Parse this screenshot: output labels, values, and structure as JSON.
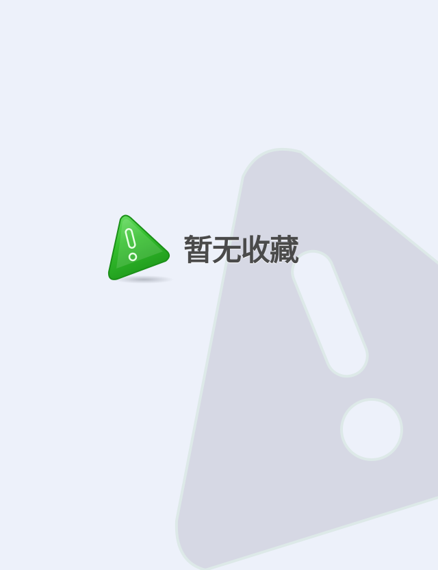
{
  "empty_state": {
    "message": "暂无收藏",
    "icon": "warning-triangle-icon",
    "icon_color": "#2fb32a"
  },
  "background": {
    "color": "#edf1fa",
    "watermark_icon": "warning-triangle-watermark-icon",
    "watermark_color": "#d6d8e4"
  }
}
